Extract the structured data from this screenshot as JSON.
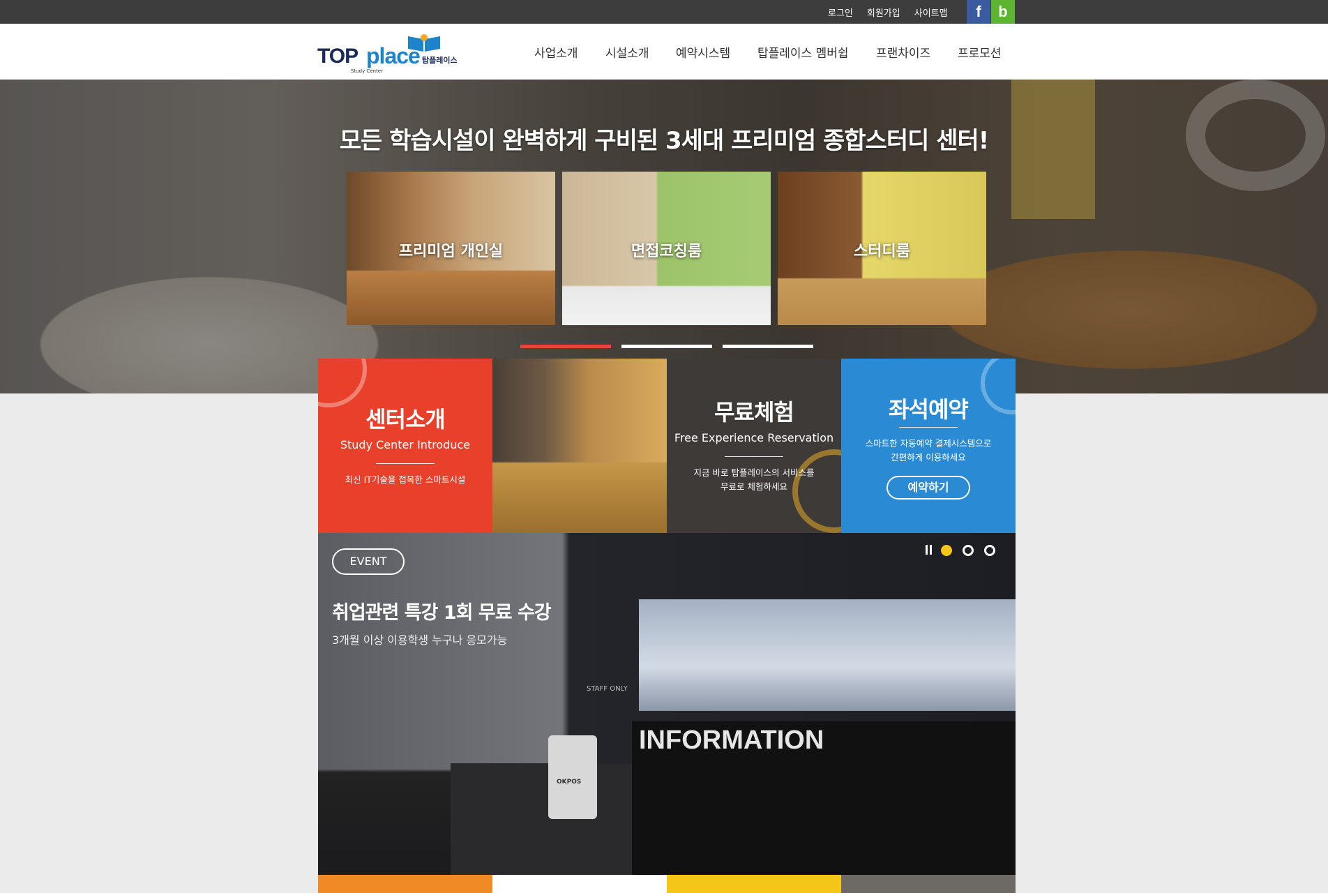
{
  "topbar": {
    "links": [
      "로그인",
      "회원가입",
      "사이트맵"
    ],
    "facebook_glyph": "f",
    "blog_glyph": "b",
    "colors": {
      "bg": "#3d3d3d",
      "facebook": "#3b5ba0",
      "blog": "#5cb531"
    }
  },
  "logo": {
    "top": "TOP",
    "place": "place",
    "korean": "탑플레이스",
    "sub": "Study Center"
  },
  "nav": [
    "사업소개",
    "시설소개",
    "예약시스템",
    "탑플레이스 멤버쉽",
    "프랜차이즈",
    "프로모션"
  ],
  "hero": {
    "title": "모든 학습시설이 완벽하게 구비된 3세대 프리미엄 종합스터디 센터!",
    "cards": [
      "프리미엄 개인실",
      "면접코칭룸",
      "스터디룸"
    ],
    "slide_count": 3,
    "active_slide": 1,
    "accent": "#e8453a"
  },
  "tiles": {
    "center": {
      "title": "센터소개",
      "en": "Study Center Introduce",
      "desc": "최신 IT기술을 접목한 스마트시설",
      "color": "#e8402a"
    },
    "free": {
      "title": "무료체험",
      "en": "Free Experience Reservation",
      "desc1": "지금 바로 탑플레이스의 서비스를",
      "desc2": "무료로 체험하세요",
      "color": "#3e3a37"
    },
    "seat": {
      "title": "좌석예약",
      "desc1": "스마트한 자동예약 결제시스템으로",
      "desc2": "간편하게 이용하세요",
      "button": "예약하기",
      "color": "#2a8ad4"
    }
  },
  "event": {
    "badge": "EVENT",
    "title": "취업관련 특강 1회 무료 수강",
    "subtitle": "3개월 이상 이용학생 누구나 응모가능",
    "photo_sign": "INFORMATION",
    "photo_door": "STAFF ONLY",
    "photo_device": "OKPOS",
    "slide_count": 3,
    "active_slide": 1,
    "accent": "#f5c518"
  },
  "strip_colors": [
    "#f08a24",
    "#ffffff",
    "#f5c518",
    "#6d6a66"
  ]
}
